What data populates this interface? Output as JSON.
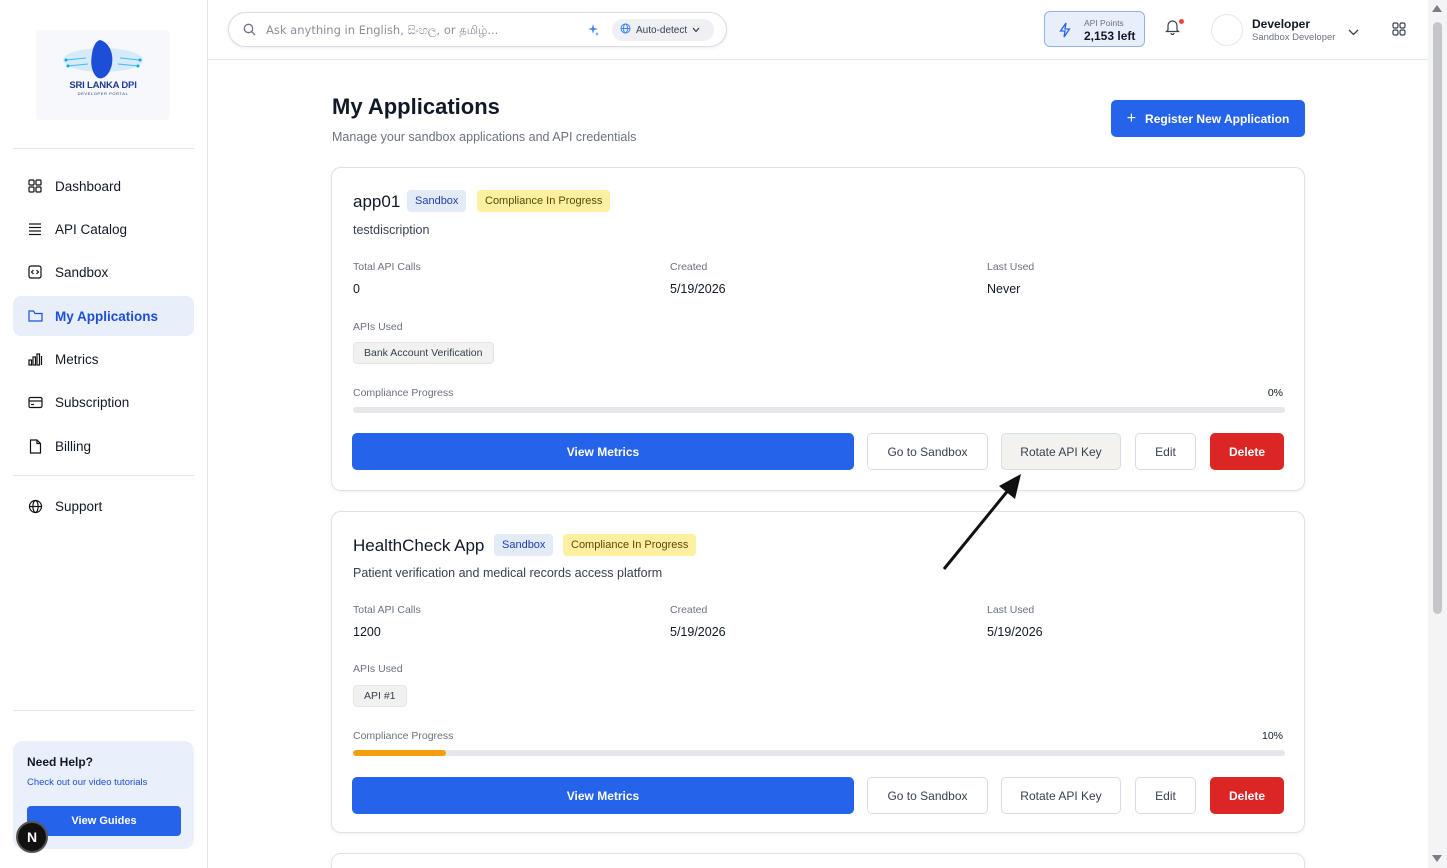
{
  "sidebar": {
    "logo": {
      "title": "SRI LANKA",
      "title_accent": "DPI",
      "subtitle": "DEVELOPER PORTAL"
    },
    "items": [
      {
        "label": "Dashboard",
        "icon": "grid-icon"
      },
      {
        "label": "API Catalog",
        "icon": "list-icon"
      },
      {
        "label": "Sandbox",
        "icon": "code-box-icon"
      },
      {
        "label": "My Applications",
        "icon": "folder-icon",
        "active": true
      },
      {
        "label": "Metrics",
        "icon": "bar-chart-icon"
      },
      {
        "label": "Subscription",
        "icon": "credit-card-icon"
      },
      {
        "label": "Billing",
        "icon": "file-icon"
      },
      {
        "label": "Support",
        "icon": "globe-icon"
      }
    ],
    "help": {
      "title": "Need Help?",
      "subtitle": "Check out our video tutorials",
      "button": "View Guides"
    },
    "badge_letter": "N"
  },
  "topbar": {
    "search_placeholder": "Ask anything in English, සිංහල, or தமிழ்...",
    "language": "Auto-detect",
    "points_label": "API Points",
    "points_value": "2,153 left",
    "user_name": "Developer",
    "user_role": "Sandbox Developer"
  },
  "main": {
    "title": "My Applications",
    "subtitle": "Manage your sandbox applications and API credentials",
    "register_button": "Register New Application"
  },
  "labels": {
    "total_calls": "Total API Calls",
    "created": "Created",
    "last_used": "Last Used",
    "apis_used": "APIs Used",
    "compliance_progress": "Compliance Progress",
    "view_metrics": "View Metrics",
    "go_to_sandbox": "Go to Sandbox",
    "rotate_key": "Rotate API Key",
    "edit": "Edit",
    "delete": "Delete"
  },
  "apps": [
    {
      "name": "app01",
      "env_badge": "Sandbox",
      "status_badge": "Compliance In Progress",
      "description": "testdiscription",
      "total_calls": "0",
      "created": "5/19/2026",
      "last_used": "Never",
      "apis": [
        "Bank Account Verification"
      ],
      "progress_text": "0%",
      "progress": 0
    },
    {
      "name": "HealthCheck App",
      "env_badge": "Sandbox",
      "status_badge": "Compliance In Progress",
      "description": "Patient verification and medical records access platform",
      "total_calls": "1200",
      "created": "5/19/2026",
      "last_used": "5/19/2026",
      "apis": [
        "API #1"
      ],
      "progress_text": "10%",
      "progress": 10
    }
  ],
  "colors": {
    "primary": "#2563eb",
    "danger": "#dc2626",
    "progress": "#f59e0b",
    "compliance_badge": "#fdf0a0",
    "sandbox_badge": "#e3ebf9"
  }
}
